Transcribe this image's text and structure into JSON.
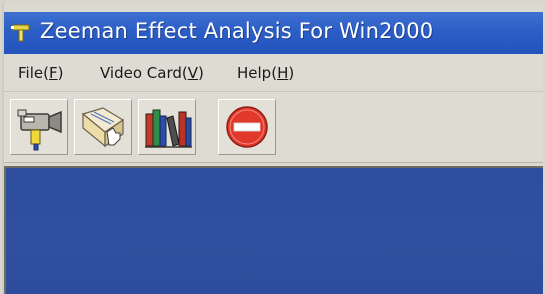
{
  "window": {
    "title": "Zeeman Effect Analysis For Win2000"
  },
  "menu": {
    "items": [
      {
        "label": "File(",
        "mnemonic": "F",
        "suffix": ")"
      },
      {
        "label": "Video Card(",
        "mnemonic": "V",
        "suffix": ")"
      },
      {
        "label": "Help(",
        "mnemonic": "H",
        "suffix": ")"
      }
    ]
  },
  "toolbar": {
    "buttons": [
      {
        "icon": "video-camera-icon"
      },
      {
        "icon": "open-document-icon"
      },
      {
        "icon": "books-library-icon"
      },
      {
        "icon": "stop-icon"
      }
    ]
  },
  "colors": {
    "titlebar": "#2c5ec7",
    "client_area": "#2f4f9f",
    "stop_red": "#e0382a"
  }
}
